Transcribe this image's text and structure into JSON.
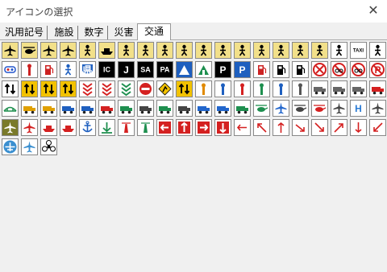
{
  "window": {
    "title": "アイコンの選択",
    "close_glyph": "✕"
  },
  "tabs": [
    {
      "label": "汎用記号",
      "active": false
    },
    {
      "label": "施設",
      "active": false
    },
    {
      "label": "数字",
      "active": false
    },
    {
      "label": "災害",
      "active": false
    },
    {
      "label": "交通",
      "active": true
    }
  ],
  "rows": [
    [
      {
        "icon": "airplane-sign-icon",
        "bg": "#f2e08a",
        "fg": "#000000"
      },
      {
        "icon": "helicopter-sign-icon",
        "bg": "#f2e08a",
        "fg": "#000000"
      },
      {
        "icon": "takeoff-sign-icon",
        "bg": "#f2e08a",
        "fg": "#000000"
      },
      {
        "icon": "landing-sign-icon",
        "bg": "#f2e08a",
        "fg": "#000000"
      },
      {
        "icon": "transfer-sign-icon",
        "bg": "#f2e08a",
        "fg": "#000000"
      },
      {
        "icon": "ship-sign-icon",
        "bg": "#f2e08a",
        "fg": "#000000"
      },
      {
        "icon": "train-sign-icon",
        "bg": "#f2e08a",
        "fg": "#000000"
      },
      {
        "icon": "ropeway-sign-icon",
        "bg": "#f2e08a",
        "fg": "#000000"
      },
      {
        "icon": "tram-sign-icon",
        "bg": "#f2e08a",
        "fg": "#000000"
      },
      {
        "icon": "bus-sign-icon",
        "bg": "#f2e08a",
        "fg": "#000000"
      },
      {
        "icon": "taxi-sign-icon",
        "bg": "#f2e08a",
        "fg": "#000000"
      },
      {
        "icon": "person-wheel-sign-icon",
        "bg": "#f2e08a",
        "fg": "#000000"
      },
      {
        "icon": "cyclist-sign-icon",
        "bg": "#f2e08a",
        "fg": "#000000"
      },
      {
        "icon": "person-walk-sign-icon",
        "bg": "#f2e08a",
        "fg": "#000000"
      },
      {
        "icon": "runner-sign-icon",
        "bg": "#f2e08a",
        "fg": "#000000"
      },
      {
        "icon": "stroller-sign-icon",
        "bg": "#f2e08a",
        "fg": "#000000"
      },
      {
        "icon": "bus-front-sign-icon",
        "bg": "#f2e08a",
        "fg": "#000000"
      },
      {
        "icon": "bus-stop-sign-icon",
        "bg": "#ffffff",
        "fg": "#000000"
      },
      {
        "icon": "taxi-text-sign-icon",
        "bg": "#ffffff",
        "fg": "#000000",
        "text": "TAXI"
      },
      {
        "icon": "bicycle-sign-icon",
        "bg": "#ffffff",
        "fg": "#000000"
      }
    ],
    [
      {
        "icon": "route-marker-icon",
        "bg": "#ffffff",
        "fg": "#2255cc"
      },
      {
        "icon": "traffic-light-icon",
        "bg": "#ffffff",
        "fg": "#cc2222"
      },
      {
        "icon": "gas-station-icon",
        "bg": "#ffffff",
        "fg": "#cc2222"
      },
      {
        "icon": "national-route-shield-icon",
        "bg": "#ffffff",
        "fg": "#1e5fbf"
      },
      {
        "icon": "prefectural-route-icon",
        "bg": "#ffffff",
        "fg": "#1e5fbf",
        "text": "県"
      },
      {
        "icon": "ic-sign-icon",
        "bg": "#000000",
        "fg": "#ffffff",
        "text": "IC"
      },
      {
        "icon": "jct-sign-icon",
        "bg": "#000000",
        "fg": "#ffffff",
        "text": "J"
      },
      {
        "icon": "sa-sign-icon",
        "bg": "#000000",
        "fg": "#ffffff",
        "text": "SA"
      },
      {
        "icon": "pa-sign-icon",
        "bg": "#000000",
        "fg": "#ffffff",
        "text": "PA"
      },
      {
        "icon": "toll-gate-icon",
        "bg": "#1e5fbf",
        "fg": "#ffffff"
      },
      {
        "icon": "rest-area-icon",
        "bg": "#ffffff",
        "fg": "#1e8f4f"
      },
      {
        "icon": "parking-sign-icon",
        "bg": "#000000",
        "fg": "#ffffff",
        "text": "P"
      },
      {
        "icon": "parking-car-sign-icon",
        "bg": "#1e5fbf",
        "fg": "#ffffff",
        "text": "P"
      },
      {
        "icon": "motorcycle-parking-icon",
        "bg": "#ffffff",
        "fg": "#cc2222"
      },
      {
        "icon": "fuel-pump-icon",
        "bg": "#ffffff",
        "fg": "#000000"
      },
      {
        "icon": "vehicle-inspection-icon",
        "bg": "#ffffff",
        "fg": "#000000"
      },
      {
        "icon": "no-entry-x-icon",
        "bg": "#ffffff",
        "fg": "#d42020"
      },
      {
        "icon": "no-parking-icon",
        "bg": "#ffffff",
        "fg": "#d42020"
      },
      {
        "icon": "no-bicycle-icon",
        "bg": "#ffffff",
        "fg": "#d42020"
      },
      {
        "icon": "no-parking-p-icon",
        "bg": "#ffffff",
        "fg": "#d42020",
        "text": "P"
      }
    ],
    [
      {
        "icon": "crossing-barrier-icon",
        "bg": "#ffffff",
        "fg": "#000000"
      },
      {
        "icon": "lane-arrows-icon",
        "bg": "#f2c200",
        "fg": "#000000"
      },
      {
        "icon": "merge-lane-icon",
        "bg": "#f2c200",
        "fg": "#000000"
      },
      {
        "icon": "double-arrow-sign-icon",
        "bg": "#f2c200",
        "fg": "#000000"
      },
      {
        "icon": "zigzag-barrier-icon",
        "bg": "#ffffff",
        "fg": "#d42020"
      },
      {
        "icon": "chevron-down-red-icon",
        "bg": "#ffffff",
        "fg": "#d42020"
      },
      {
        "icon": "chevron-down-green-icon",
        "bg": "#ffffff",
        "fg": "#1e8f4f"
      },
      {
        "icon": "do-not-enter-icon",
        "bg": "#ffffff",
        "fg": "#d42020"
      },
      {
        "icon": "road-work-icon",
        "bg": "#ffffff",
        "fg": "#f2c200"
      },
      {
        "icon": "slope-sign-icon",
        "bg": "#f2c200",
        "fg": "#000000"
      },
      {
        "icon": "guide-pole-icon",
        "bg": "#ffffff",
        "fg": "#e08a00"
      },
      {
        "icon": "sign-post-icon",
        "bg": "#ffffff",
        "fg": "#1e5fbf"
      },
      {
        "icon": "sign-post-red-icon",
        "bg": "#ffffff",
        "fg": "#d42020"
      },
      {
        "icon": "signal-pole-icon",
        "bg": "#ffffff",
        "fg": "#1e8f4f"
      },
      {
        "icon": "traffic-officer-icon",
        "bg": "#ffffff",
        "fg": "#1e5fbf"
      },
      {
        "icon": "street-light-icon",
        "bg": "#ffffff",
        "fg": "#555555"
      },
      {
        "icon": "dump-truck-icon",
        "bg": "#ffffff",
        "fg": "#666666"
      },
      {
        "icon": "tanker-truck-icon",
        "bg": "#ffffff",
        "fg": "#666666"
      },
      {
        "icon": "tow-truck-icon",
        "bg": "#ffffff",
        "fg": "#666666"
      },
      {
        "icon": "fire-truck-icon",
        "bg": "#ffffff",
        "fg": "#d42020"
      }
    ],
    [
      {
        "icon": "bridge-icon",
        "bg": "#ffffff",
        "fg": "#1e8f4f"
      },
      {
        "icon": "excavator-icon",
        "bg": "#ffffff",
        "fg": "#e0a000"
      },
      {
        "icon": "bulldozer-icon",
        "bg": "#ffffff",
        "fg": "#e0a000"
      },
      {
        "icon": "police-car-icon",
        "bg": "#ffffff",
        "fg": "#1e5fbf"
      },
      {
        "icon": "patrol-car-icon",
        "bg": "#ffffff",
        "fg": "#1e5fbf"
      },
      {
        "icon": "fire-engine-icon",
        "bg": "#ffffff",
        "fg": "#d42020"
      },
      {
        "icon": "freight-truck-icon",
        "bg": "#ffffff",
        "fg": "#1e8f4f"
      },
      {
        "icon": "wrecker-icon",
        "bg": "#ffffff",
        "fg": "#444444"
      },
      {
        "icon": "cement-truck-icon",
        "bg": "#ffffff",
        "fg": "#1e8f4f"
      },
      {
        "icon": "sedan-icon",
        "bg": "#ffffff",
        "fg": "#444444"
      },
      {
        "icon": "pickup-icon",
        "bg": "#ffffff",
        "fg": "#2266cc"
      },
      {
        "icon": "ambulance-icon",
        "bg": "#ffffff",
        "fg": "#2266cc"
      },
      {
        "icon": "bus-side-icon",
        "bg": "#ffffff",
        "fg": "#1e8f4f"
      },
      {
        "icon": "small-helicopter-icon",
        "bg": "#ffffff",
        "fg": "#1e8f4f"
      },
      {
        "icon": "jet-icon",
        "bg": "#ffffff",
        "fg": "#2266cc"
      },
      {
        "icon": "drone-icon",
        "bg": "#ffffff",
        "fg": "#444444"
      },
      {
        "icon": "rescue-helicopter-icon",
        "bg": "#ffffff",
        "fg": "#d42020"
      },
      {
        "icon": "airliner-icon",
        "bg": "#ffffff",
        "fg": "#444444"
      },
      {
        "icon": "helipad-icon",
        "bg": "#ffffff",
        "fg": "#2b7bd4",
        "text": "H"
      },
      {
        "icon": "cargo-plane-icon",
        "bg": "#ffffff",
        "fg": "#444444"
      }
    ],
    [
      {
        "icon": "army-plane-icon",
        "bg": "#7a7a2a",
        "fg": "#ffffff"
      },
      {
        "icon": "plane-red-icon",
        "bg": "#ffffff",
        "fg": "#d42020"
      },
      {
        "icon": "boat-icon",
        "bg": "#ffffff",
        "fg": "#d42020"
      },
      {
        "icon": "ferry-icon",
        "bg": "#ffffff",
        "fg": "#d42020"
      },
      {
        "icon": "anchor-icon",
        "bg": "#ffffff",
        "fg": "#1e5fbf"
      },
      {
        "icon": "port-arrow-icon",
        "bg": "#ffffff",
        "fg": "#1e8f4f"
      },
      {
        "icon": "buoy-icon",
        "bg": "#ffffff",
        "fg": "#d42020"
      },
      {
        "icon": "lighthouse-icon",
        "bg": "#ffffff",
        "fg": "#1e8f4f"
      },
      {
        "icon": "left-arrow-box-icon",
        "bg": "#ffffff",
        "fg": "#d42020"
      },
      {
        "icon": "up-arrow-box-icon",
        "bg": "#ffffff",
        "fg": "#d42020"
      },
      {
        "icon": "right-arrow-box-icon",
        "bg": "#ffffff",
        "fg": "#d42020"
      },
      {
        "icon": "down-arrow-box-icon",
        "bg": "#ffffff",
        "fg": "#d42020"
      },
      {
        "icon": "arrow-left-thin-icon",
        "bg": "#ffffff",
        "fg": "#d42020"
      },
      {
        "icon": "arrow-up-left-icon",
        "bg": "#ffffff",
        "fg": "#d42020"
      },
      {
        "icon": "arrow-up-thin-icon",
        "bg": "#ffffff",
        "fg": "#d42020"
      },
      {
        "icon": "arrow-down-right-icon",
        "bg": "#ffffff",
        "fg": "#d42020"
      },
      {
        "icon": "arrow-right-down-icon",
        "bg": "#ffffff",
        "fg": "#d42020"
      },
      {
        "icon": "arrow-up-right-icon",
        "bg": "#ffffff",
        "fg": "#d42020"
      },
      {
        "icon": "arrow-down-thin-icon",
        "bg": "#ffffff",
        "fg": "#d42020"
      },
      {
        "icon": "arrow-down-left-icon",
        "bg": "#ffffff",
        "fg": "#d42020"
      }
    ],
    [
      {
        "icon": "airport-circle-icon",
        "bg": "#ffffff",
        "fg": "#3a8fd0"
      },
      {
        "icon": "airplane-small-icon",
        "bg": "#ffffff",
        "fg": "#3a8fd0"
      },
      {
        "icon": "propeller-icon",
        "bg": "#ffffff",
        "fg": "#000000"
      }
    ]
  ]
}
